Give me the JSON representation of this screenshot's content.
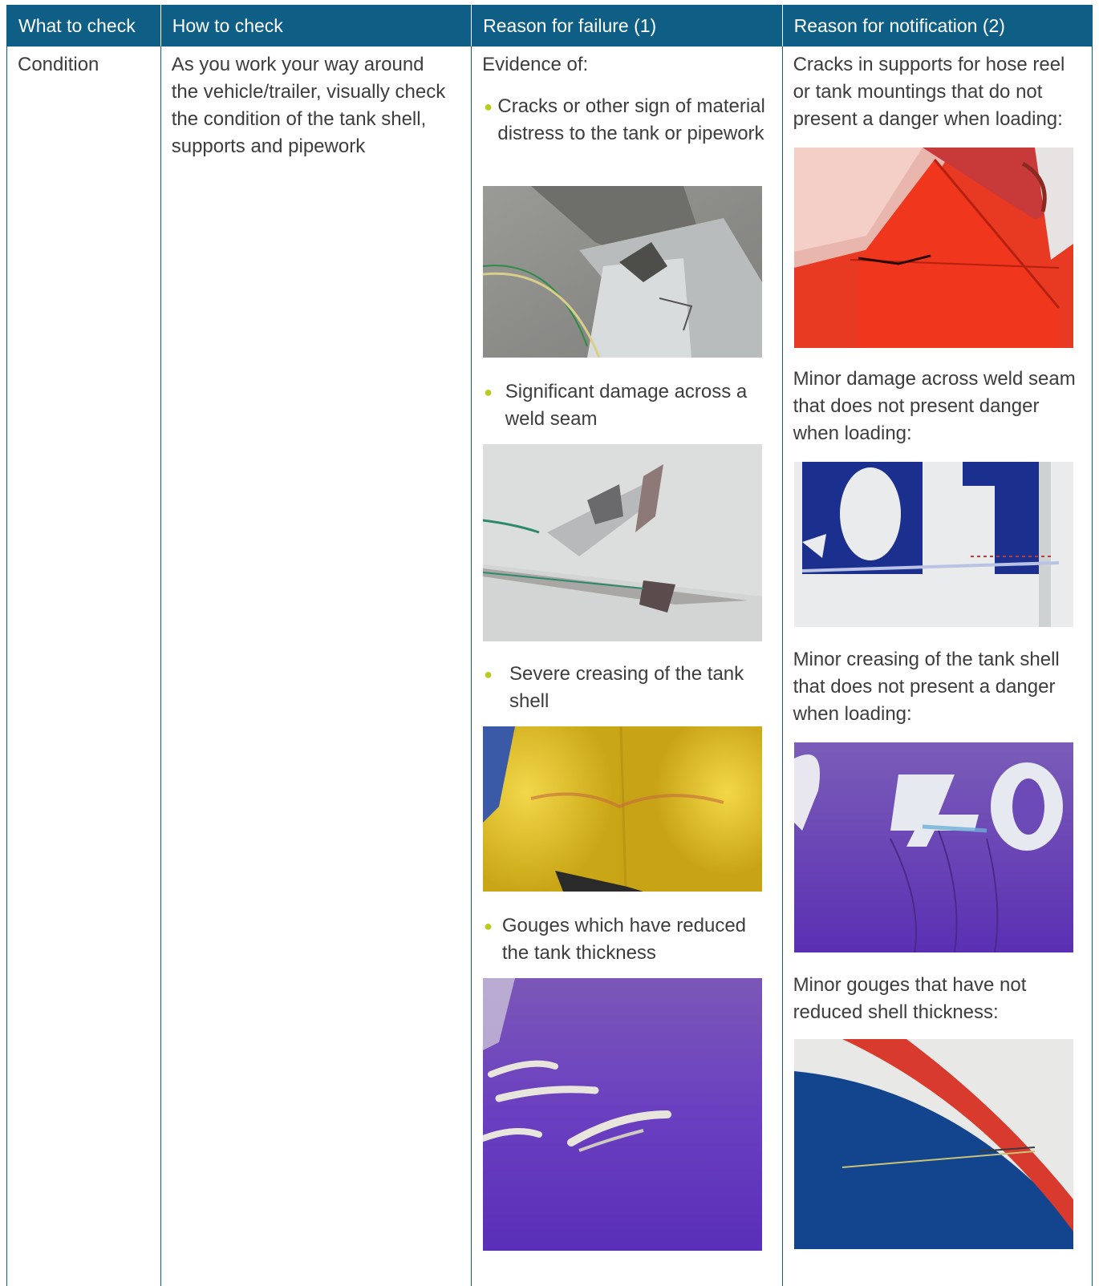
{
  "header": {
    "col1": "What to check",
    "col2": "How to check",
    "col3": "Reason for failure (1)",
    "col4": "Reason for notification (2)"
  },
  "row": {
    "what": "Condition",
    "how": "As you work your way around the vehicle/trailer, visually check the condition of the tank shell, supports and pipework",
    "failure": {
      "intro": "Evidence of:",
      "items": [
        {
          "text": "Cracks or other sign of material distress to the tank or pipework",
          "photo": "cracked-pipework-photo"
        },
        {
          "text": "Significant damage across a weld seam",
          "photo": "weld-seam-damage-photo"
        },
        {
          "text": "Severe creasing of the tank shell",
          "photo": "tank-shell-crease-photo"
        },
        {
          "text": "Gouges which have reduced the tank thickness",
          "photo": "deep-gouges-photo"
        }
      ]
    },
    "notification": {
      "items": [
        {
          "text": "Cracks in supports for hose reel or tank mountings that do not present a danger when loading:",
          "photo": "cracked-support-photo"
        },
        {
          "text": "Minor damage across weld seam that does not present danger when loading:",
          "photo": "minor-weld-damage-photo"
        },
        {
          "text": "Minor creasing of the tank shell that does not present a danger when loading:",
          "photo": "minor-crease-photo"
        },
        {
          "text": "Minor gouges that have not reduced shell thickness:",
          "photo": "minor-gouges-photo"
        }
      ]
    }
  },
  "colors": {
    "header_bg": "#0e5e86",
    "bullet": "#b9cc1c",
    "text": "#3d3d3d"
  }
}
